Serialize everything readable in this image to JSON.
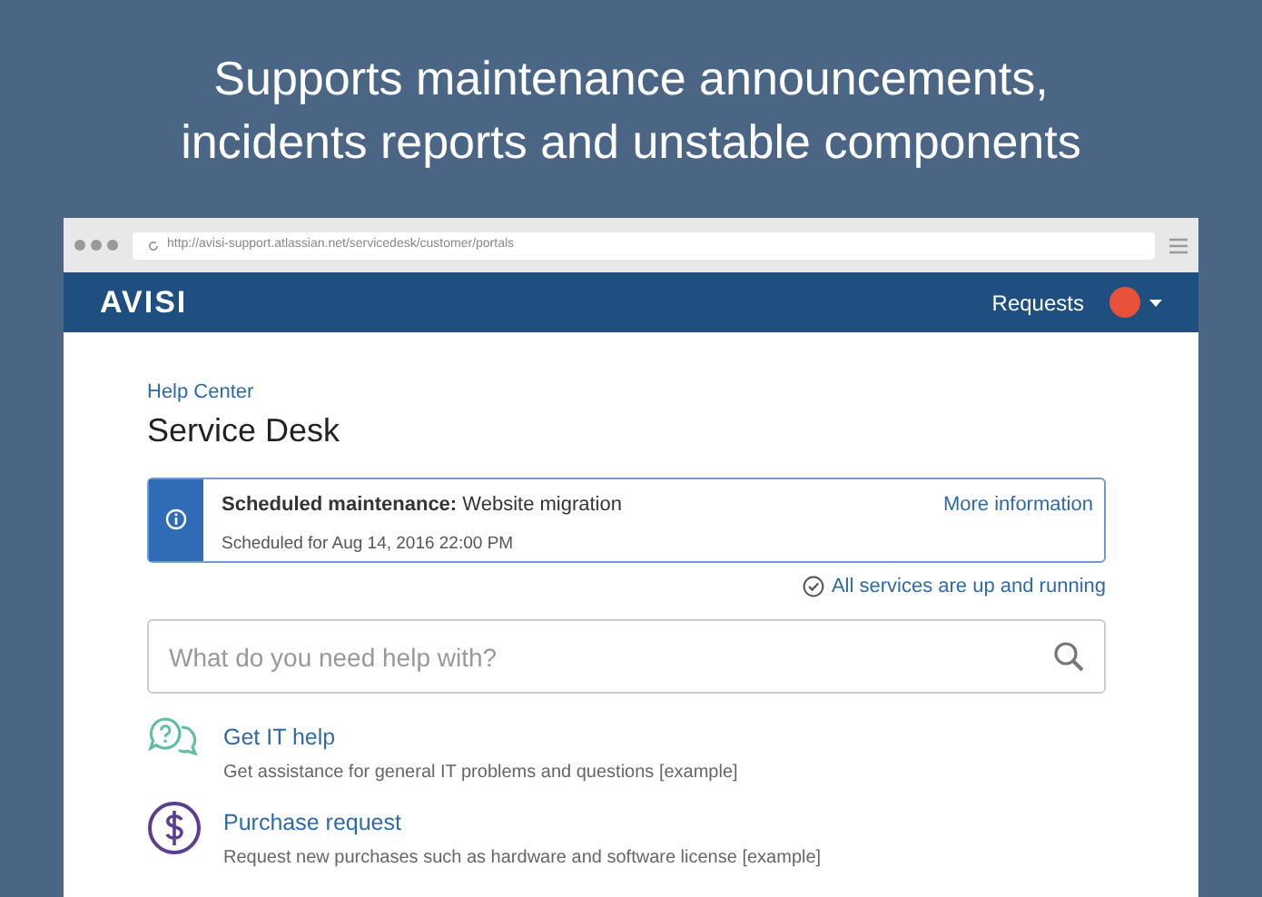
{
  "headline": [
    "Supports maintenance announcements,",
    "incidents reports and unstable components"
  ],
  "browser": {
    "url": "http://avisi-support.atlassian.net/servicedesk/customer/portals"
  },
  "navbar": {
    "logo": "AVISI",
    "requests_link": "Requests"
  },
  "breadcrumb": "Help Center",
  "title": "Service Desk",
  "announcement": {
    "text": "**Scheduled maintenance:** Website migration",
    "schedule": "Scheduled for Aug 14, 2016 22:00 PM",
    "link": "More information"
  },
  "status": {
    "text": "All services are up and running"
  },
  "search": {
    "placeholder": "What do you need help with?"
  },
  "request_types": [
    {
      "kind": "question",
      "title": "Get IT help",
      "description": "Get assistance for general IT problems and questions [example]",
      "color": "#5fbf9f"
    },
    {
      "kind": "dollar",
      "title": "Purchase request",
      "description": "Request new purchases such as hardware and software license [example]",
      "color": "#5b3e8f"
    }
  ]
}
